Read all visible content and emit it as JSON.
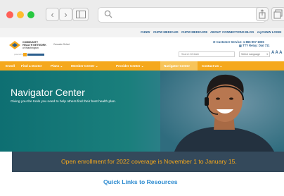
{
  "browser": {
    "back_glyph": "‹",
    "forward_glyph": "›",
    "icons": [
      "sidebar-icon",
      "search-icon",
      "share-icon",
      "tabs-icon"
    ]
  },
  "top_nav": [
    "CHNW",
    "CHPW MEDICAID",
    "CHPW MEDICARE",
    "ABOUT",
    "CONNECTIONS BLOG",
    "myCHNW LOGIN"
  ],
  "header": {
    "logo_line1": "COMMUNITY",
    "logo_line2": "HEALTH NETWORK",
    "logo_line3": "of Washington",
    "logo_sub": "Cascade Select",
    "partner_label": "powered by",
    "customer_service": "Customer Service: 1-866-907-1906",
    "tty": "TTY Relay: Dial 711",
    "search_placeholder": "Search Website",
    "language": "Select Language",
    "text_size": "A A A"
  },
  "main_nav": {
    "items": [
      "Enroll",
      "Find a Doctor",
      "Plans ⌄",
      "Member Center ⌄",
      "Provider Center ⌄",
      "Navigator Center",
      "Contact Us ⌄"
    ],
    "active": "Navigator Center"
  },
  "hero": {
    "title": "Navigator Center",
    "subtitle": "Giving you the tools you need to help others find their best health plan."
  },
  "banner": {
    "text": "Open enrollment for 2022 coverage is November 1 to January 15."
  },
  "quick_links": {
    "title": "Quick Links to Resources"
  },
  "colors": {
    "orange": "#f5a81c",
    "blue": "#2b5f8e",
    "teal": "#0e6f72",
    "banner": "#34495b"
  }
}
